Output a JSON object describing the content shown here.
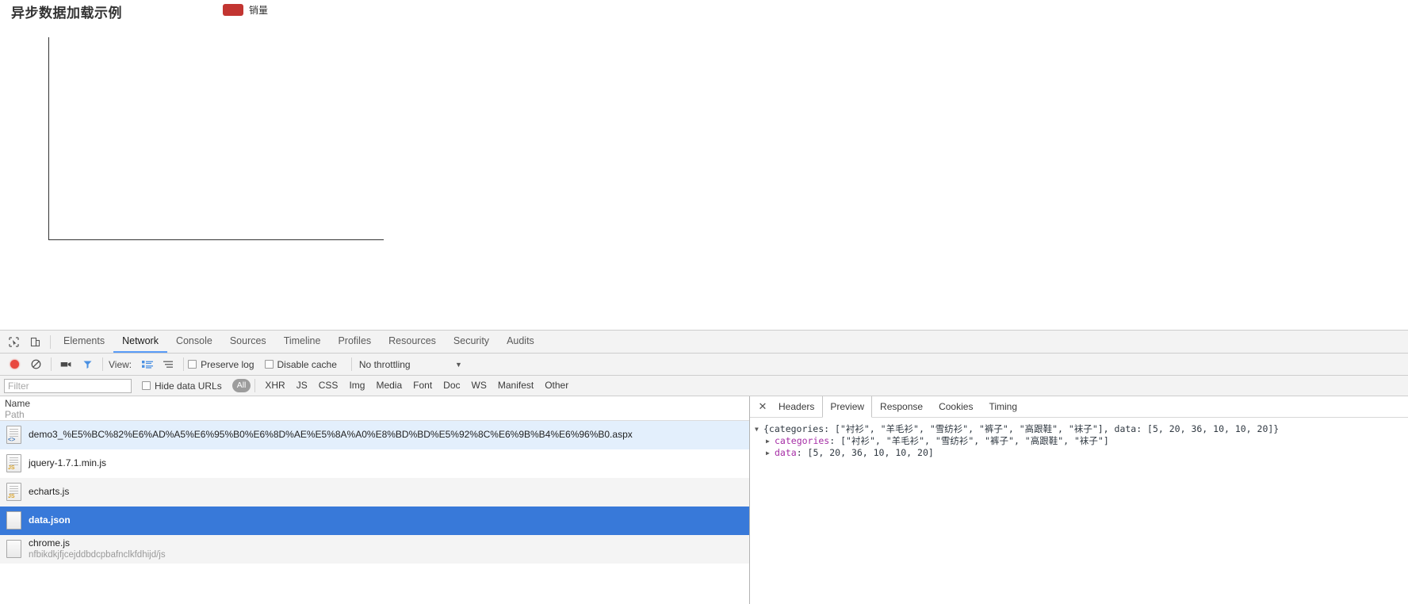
{
  "chart": {
    "title": "异步数据加载示例",
    "legend_label": "销量",
    "legend_color": "#c23531"
  },
  "chart_data": {
    "type": "bar",
    "title": "异步数据加载示例",
    "categories": [
      "衬衫",
      "羊毛衫",
      "雪纺衫",
      "裤子",
      "高跟鞋",
      "袜子"
    ],
    "series": [
      {
        "name": "销量",
        "values": [
          5,
          20,
          36,
          10,
          10,
          20
        ],
        "color": "#c23531"
      }
    ],
    "rendered": false,
    "note": "Axes drawn, no bars or tick labels rendered yet (data still loading)",
    "xlabel": "",
    "ylabel": "",
    "grid": false,
    "legend_position": "top-center"
  },
  "devtools": {
    "icons": {
      "inspect": "inspect-icon",
      "device": "device-toolbar-icon",
      "record": "record-icon",
      "clear": "clear-icon",
      "capture": "capture-screenshots-icon",
      "filter": "filter-icon",
      "large_rows": "large-request-rows-icon",
      "overview": "capture-overview-icon"
    },
    "tabs": [
      {
        "label": "Elements",
        "active": false
      },
      {
        "label": "Network",
        "active": true
      },
      {
        "label": "Console",
        "active": false
      },
      {
        "label": "Sources",
        "active": false
      },
      {
        "label": "Timeline",
        "active": false
      },
      {
        "label": "Profiles",
        "active": false
      },
      {
        "label": "Resources",
        "active": false
      },
      {
        "label": "Security",
        "active": false
      },
      {
        "label": "Audits",
        "active": false
      }
    ],
    "toolbar": {
      "view_label": "View:",
      "preserve_log": "Preserve log",
      "disable_cache": "Disable cache",
      "throttling": "No throttling",
      "throttling_caret": "▼"
    },
    "filterbar": {
      "filter_placeholder": "Filter",
      "filter_value": "",
      "hide_data_urls": "Hide data URLs",
      "types": [
        {
          "label": "All",
          "active": true
        },
        {
          "label": "XHR",
          "active": false
        },
        {
          "label": "JS",
          "active": false
        },
        {
          "label": "CSS",
          "active": false
        },
        {
          "label": "Img",
          "active": false
        },
        {
          "label": "Media",
          "active": false
        },
        {
          "label": "Font",
          "active": false
        },
        {
          "label": "Doc",
          "active": false
        },
        {
          "label": "WS",
          "active": false
        },
        {
          "label": "Manifest",
          "active": false
        },
        {
          "label": "Other",
          "active": false
        }
      ]
    },
    "requests": {
      "header_name": "Name",
      "header_path": "Path",
      "rows": [
        {
          "name": "demo3_%E5%BC%82%E6%AD%A5%E6%95%B0%E6%8D%AE%E5%8A%A0%E8%BD%BD%E5%92%8C%E6%9B%B4%E6%96%B0.aspx",
          "path": "",
          "icon": "document-file-icon",
          "badge": "<>",
          "state": "highlight"
        },
        {
          "name": "jquery-1.7.1.min.js",
          "path": "",
          "icon": "script-file-icon",
          "badge": "JS",
          "state": "plain"
        },
        {
          "name": "echarts.js",
          "path": "",
          "icon": "script-file-icon",
          "badge": "JS",
          "state": "stripe"
        },
        {
          "name": "data.json",
          "path": "",
          "icon": "generic-file-icon",
          "badge": "",
          "state": "selected"
        },
        {
          "name": "chrome.js",
          "path": "nfbikdkjfjcejddbdcpbafnclkfdhijd/js",
          "icon": "generic-file-icon",
          "badge": "",
          "state": "stripe"
        }
      ]
    },
    "detail": {
      "close_label": "✕",
      "tabs": [
        {
          "label": "Headers",
          "active": false
        },
        {
          "label": "Preview",
          "active": true
        },
        {
          "label": "Response",
          "active": false
        },
        {
          "label": "Cookies",
          "active": false
        },
        {
          "label": "Timing",
          "active": false
        }
      ],
      "preview": {
        "root": "{categories: [\"衬衫\", \"羊毛衫\", \"雪纺衫\", \"裤子\", \"高跟鞋\", \"袜子\"], data: [5, 20, 36, 10, 10, 20]}",
        "categories_key": "categories",
        "categories_value": ": [\"衬衫\", \"羊毛衫\", \"雪纺衫\", \"裤子\", \"高跟鞋\", \"袜子\"]",
        "data_key": "data",
        "data_value": ": [5, 20, 36, 10, 10, 20]"
      }
    }
  }
}
